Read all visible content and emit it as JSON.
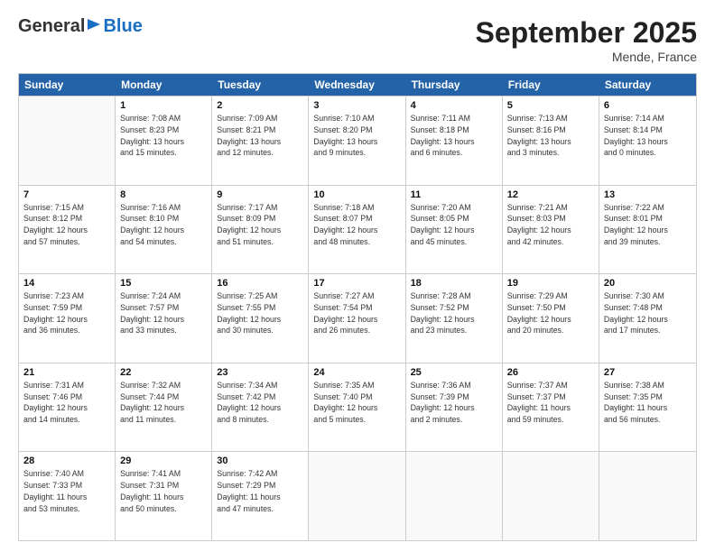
{
  "logo": {
    "general": "General",
    "blue": "Blue"
  },
  "title": "September 2025",
  "subtitle": "Mende, France",
  "calendar": {
    "headers": [
      "Sunday",
      "Monday",
      "Tuesday",
      "Wednesday",
      "Thursday",
      "Friday",
      "Saturday"
    ],
    "rows": [
      [
        {
          "day": "",
          "info": ""
        },
        {
          "day": "1",
          "info": "Sunrise: 7:08 AM\nSunset: 8:23 PM\nDaylight: 13 hours\nand 15 minutes."
        },
        {
          "day": "2",
          "info": "Sunrise: 7:09 AM\nSunset: 8:21 PM\nDaylight: 13 hours\nand 12 minutes."
        },
        {
          "day": "3",
          "info": "Sunrise: 7:10 AM\nSunset: 8:20 PM\nDaylight: 13 hours\nand 9 minutes."
        },
        {
          "day": "4",
          "info": "Sunrise: 7:11 AM\nSunset: 8:18 PM\nDaylight: 13 hours\nand 6 minutes."
        },
        {
          "day": "5",
          "info": "Sunrise: 7:13 AM\nSunset: 8:16 PM\nDaylight: 13 hours\nand 3 minutes."
        },
        {
          "day": "6",
          "info": "Sunrise: 7:14 AM\nSunset: 8:14 PM\nDaylight: 13 hours\nand 0 minutes."
        }
      ],
      [
        {
          "day": "7",
          "info": "Sunrise: 7:15 AM\nSunset: 8:12 PM\nDaylight: 12 hours\nand 57 minutes."
        },
        {
          "day": "8",
          "info": "Sunrise: 7:16 AM\nSunset: 8:10 PM\nDaylight: 12 hours\nand 54 minutes."
        },
        {
          "day": "9",
          "info": "Sunrise: 7:17 AM\nSunset: 8:09 PM\nDaylight: 12 hours\nand 51 minutes."
        },
        {
          "day": "10",
          "info": "Sunrise: 7:18 AM\nSunset: 8:07 PM\nDaylight: 12 hours\nand 48 minutes."
        },
        {
          "day": "11",
          "info": "Sunrise: 7:20 AM\nSunset: 8:05 PM\nDaylight: 12 hours\nand 45 minutes."
        },
        {
          "day": "12",
          "info": "Sunrise: 7:21 AM\nSunset: 8:03 PM\nDaylight: 12 hours\nand 42 minutes."
        },
        {
          "day": "13",
          "info": "Sunrise: 7:22 AM\nSunset: 8:01 PM\nDaylight: 12 hours\nand 39 minutes."
        }
      ],
      [
        {
          "day": "14",
          "info": "Sunrise: 7:23 AM\nSunset: 7:59 PM\nDaylight: 12 hours\nand 36 minutes."
        },
        {
          "day": "15",
          "info": "Sunrise: 7:24 AM\nSunset: 7:57 PM\nDaylight: 12 hours\nand 33 minutes."
        },
        {
          "day": "16",
          "info": "Sunrise: 7:25 AM\nSunset: 7:55 PM\nDaylight: 12 hours\nand 30 minutes."
        },
        {
          "day": "17",
          "info": "Sunrise: 7:27 AM\nSunset: 7:54 PM\nDaylight: 12 hours\nand 26 minutes."
        },
        {
          "day": "18",
          "info": "Sunrise: 7:28 AM\nSunset: 7:52 PM\nDaylight: 12 hours\nand 23 minutes."
        },
        {
          "day": "19",
          "info": "Sunrise: 7:29 AM\nSunset: 7:50 PM\nDaylight: 12 hours\nand 20 minutes."
        },
        {
          "day": "20",
          "info": "Sunrise: 7:30 AM\nSunset: 7:48 PM\nDaylight: 12 hours\nand 17 minutes."
        }
      ],
      [
        {
          "day": "21",
          "info": "Sunrise: 7:31 AM\nSunset: 7:46 PM\nDaylight: 12 hours\nand 14 minutes."
        },
        {
          "day": "22",
          "info": "Sunrise: 7:32 AM\nSunset: 7:44 PM\nDaylight: 12 hours\nand 11 minutes."
        },
        {
          "day": "23",
          "info": "Sunrise: 7:34 AM\nSunset: 7:42 PM\nDaylight: 12 hours\nand 8 minutes."
        },
        {
          "day": "24",
          "info": "Sunrise: 7:35 AM\nSunset: 7:40 PM\nDaylight: 12 hours\nand 5 minutes."
        },
        {
          "day": "25",
          "info": "Sunrise: 7:36 AM\nSunset: 7:39 PM\nDaylight: 12 hours\nand 2 minutes."
        },
        {
          "day": "26",
          "info": "Sunrise: 7:37 AM\nSunset: 7:37 PM\nDaylight: 11 hours\nand 59 minutes."
        },
        {
          "day": "27",
          "info": "Sunrise: 7:38 AM\nSunset: 7:35 PM\nDaylight: 11 hours\nand 56 minutes."
        }
      ],
      [
        {
          "day": "28",
          "info": "Sunrise: 7:40 AM\nSunset: 7:33 PM\nDaylight: 11 hours\nand 53 minutes."
        },
        {
          "day": "29",
          "info": "Sunrise: 7:41 AM\nSunset: 7:31 PM\nDaylight: 11 hours\nand 50 minutes."
        },
        {
          "day": "30",
          "info": "Sunrise: 7:42 AM\nSunset: 7:29 PM\nDaylight: 11 hours\nand 47 minutes."
        },
        {
          "day": "",
          "info": ""
        },
        {
          "day": "",
          "info": ""
        },
        {
          "day": "",
          "info": ""
        },
        {
          "day": "",
          "info": ""
        }
      ]
    ]
  }
}
